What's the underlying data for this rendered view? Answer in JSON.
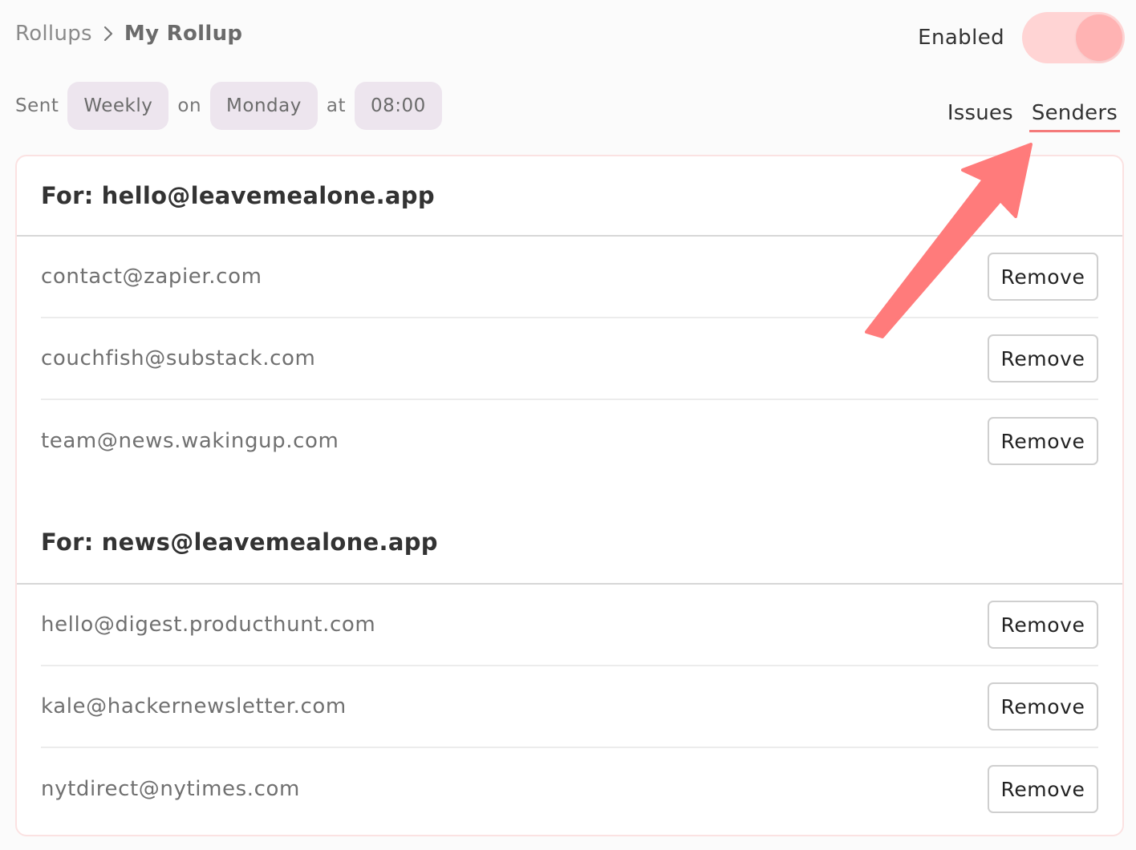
{
  "breadcrumb": {
    "root": "Rollups",
    "current": "My Rollup"
  },
  "enabled": {
    "label": "Enabled",
    "state": true
  },
  "schedule": {
    "sent_label": "Sent",
    "frequency": "Weekly",
    "on_label": "on",
    "day": "Monday",
    "at_label": "at",
    "time": "08:00"
  },
  "tabs": [
    {
      "label": "Issues",
      "active": false
    },
    {
      "label": "Senders",
      "active": true
    }
  ],
  "groups": [
    {
      "prefix": "For:",
      "email": "hello@leavemealone.app",
      "senders": [
        {
          "email": "contact@zapier.com",
          "action": "Remove"
        },
        {
          "email": "couchfish@substack.com",
          "action": "Remove"
        },
        {
          "email": "team@news.wakingup.com",
          "action": "Remove"
        }
      ]
    },
    {
      "prefix": "For:",
      "email": "news@leavemealone.app",
      "senders": [
        {
          "email": "hello@digest.producthunt.com",
          "action": "Remove"
        },
        {
          "email": "kale@hackernewsletter.com",
          "action": "Remove"
        },
        {
          "email": "nytdirect@nytimes.com",
          "action": "Remove"
        }
      ]
    }
  ],
  "colors": {
    "accent": "#f47a7a",
    "toggle_track": "#ffd4d4",
    "toggle_knob": "#ffb3b3",
    "pill_bg": "#ede5ee",
    "annotation_arrow": "#ff7b7b"
  },
  "icons": {
    "breadcrumb_separator": "chevron-right-icon",
    "annotation": "arrow-annotation-icon"
  }
}
